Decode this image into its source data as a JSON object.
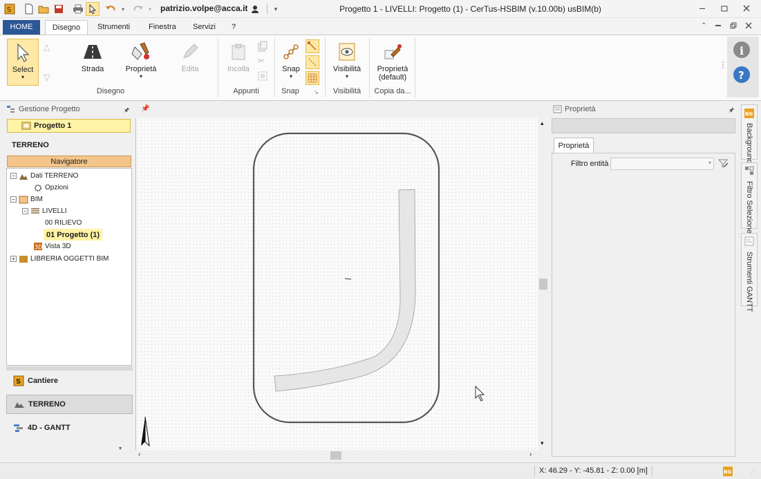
{
  "titlebar": {
    "user_email": "patrizio.volpe@acca.it",
    "window_title": "Progetto 1 -  LIVELLI: Progetto (1) - CerTus-HSBIM (v.10.00b) usBIM(b)"
  },
  "ribbon": {
    "tabs": [
      "HOME",
      "Disegno",
      "Strumenti",
      "Finestra",
      "Servizi",
      "?"
    ],
    "active_tab": "Disegno",
    "buttons": {
      "select": "Select",
      "strada": "Strada",
      "proprieta": "Proprietà",
      "edita": "Edita",
      "incolla": "Incolla",
      "snap": "Snap",
      "visibilita": "Visibilità",
      "proprieta_default_1": "Proprietà",
      "proprieta_default_2": "(default)"
    },
    "groups": {
      "disegno": "Disegno",
      "appunti": "Appunti",
      "snap": "Snap",
      "visibilita": "Visibilità",
      "copia": "Copia da..."
    }
  },
  "left_panel": {
    "title": "Gestione Progetto",
    "project": "Progetto 1",
    "section": "TERRENO",
    "navigator": "Navigatore",
    "tree": {
      "dati": "Dati TERRENO",
      "opzioni": "Opzioni",
      "bim": "BIM",
      "livelli": "LIVELLI",
      "rilievo": "00 RILIEVO",
      "progetto": "01 Progetto (1)",
      "vista3d": "Vista 3D",
      "libreria": "LIBRERIA OGGETTI BIM"
    },
    "modules": {
      "cantiere": "Cantiere",
      "terreno": "TERRENO",
      "gantt": "4D - GANTT"
    }
  },
  "right_panel": {
    "title": "Proprietà",
    "tab": "Proprietà",
    "filter_label": "Filtro entità"
  },
  "side_tabs": {
    "background": "Background",
    "filtro": "Filtro Selezione",
    "gantt": "Strumenti GANTT"
  },
  "statusbar": {
    "coords": "X: 46.29 - Y: -45.81 - Z: 0.00 [m]"
  },
  "colors": {
    "accent": "#2b5797",
    "selection": "#fde8a6",
    "navigator": "#f4c58a"
  }
}
